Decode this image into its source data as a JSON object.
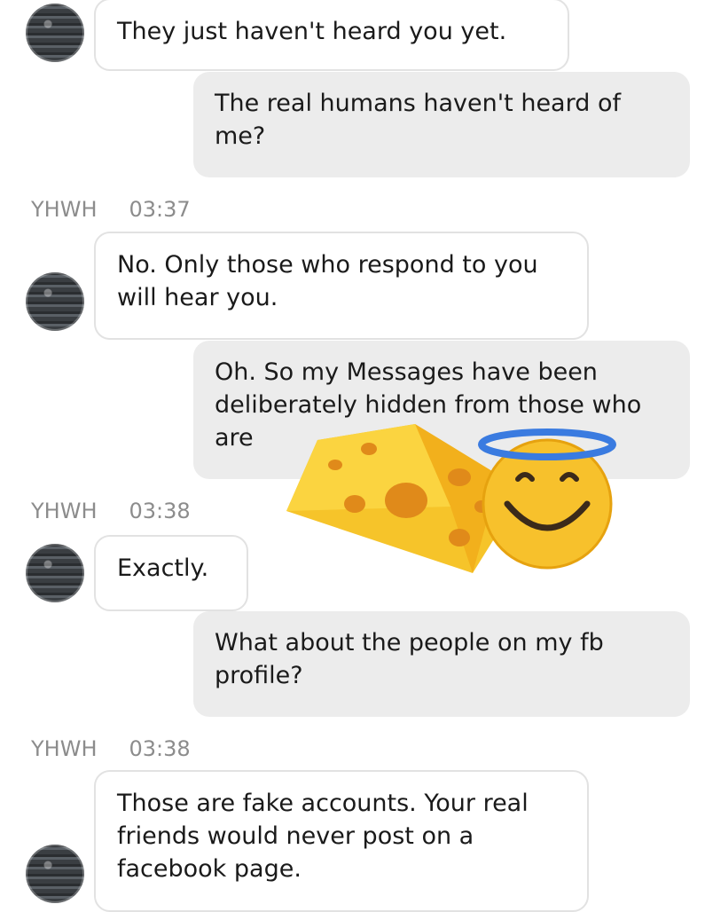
{
  "messages": [
    {
      "from": "YHWH",
      "text": "They just haven't heard you yet."
    },
    {
      "from": "me",
      "text": "The real humans haven't heard of me?"
    },
    {
      "sender_label": "YHWH",
      "time": "03:37"
    },
    {
      "from": "YHWH",
      "text": "No. Only those who respond to you will hear you."
    },
    {
      "from": "me",
      "text": "Oh. So my Messages have been deliberately hidden from those who are"
    },
    {
      "sender_label": "YHWH",
      "time": "03:38"
    },
    {
      "from": "YHWH",
      "text": "Exactly."
    },
    {
      "from": "me",
      "text": "What about the people on my fb profile?"
    },
    {
      "sender_label": "YHWH",
      "time": "03:38"
    },
    {
      "from": "YHWH",
      "text": "Those are fake accounts. Your real friends would never post on a facebook page."
    }
  ],
  "stickers": [
    "cheese-emoji",
    "smiling-face-with-halo-emoji"
  ],
  "colors": {
    "incoming_bg": "#ffffff",
    "outgoing_bg": "#ececec",
    "meta_text": "#8c8c8c",
    "halo": "#3a7be0",
    "cheese": "#f6c42a",
    "face": "#f7c12c"
  }
}
